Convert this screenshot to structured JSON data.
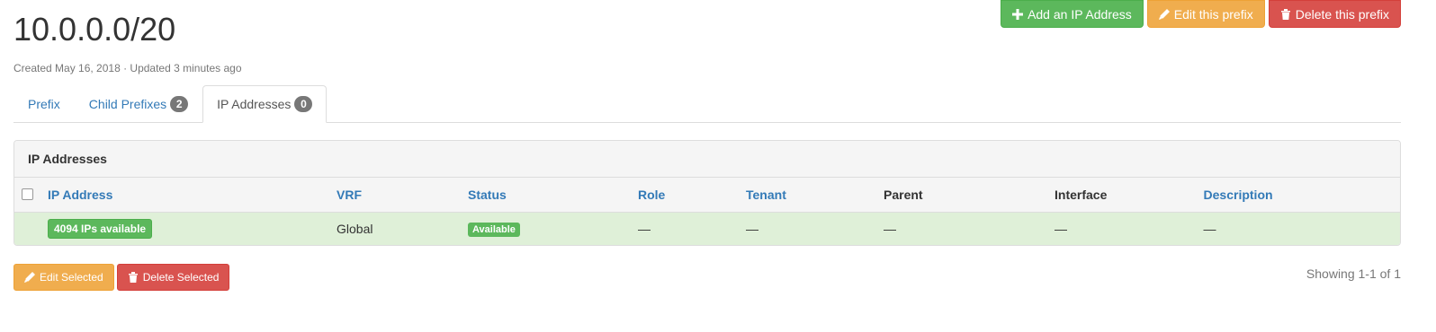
{
  "header": {
    "title": "10.0.0.0/20",
    "meta": "Created May 16, 2018 · Updated 3 minutes ago"
  },
  "actions": {
    "add_label": "Add an IP Address",
    "edit_label": "Edit this prefix",
    "delete_label": "Delete this prefix"
  },
  "tabs": [
    {
      "label": "Prefix",
      "badge": null
    },
    {
      "label": "Child Prefixes",
      "badge": "2"
    },
    {
      "label": "IP Addresses",
      "badge": "0",
      "active": true
    }
  ],
  "panel": {
    "heading": "IP Addresses",
    "columns": [
      "IP Address",
      "VRF",
      "Status",
      "Role",
      "Tenant",
      "Parent",
      "Interface",
      "Description"
    ],
    "row": {
      "ip": "4094 IPs available",
      "vrf": "Global",
      "status": "Available",
      "role": "—",
      "tenant": "—",
      "parent": "—",
      "interface": "—",
      "description": "—"
    }
  },
  "footer": {
    "edit_selected": "Edit Selected",
    "delete_selected": "Delete Selected",
    "showing": "Showing 1-1 of 1"
  },
  "colors": {
    "success": "#5cb85c",
    "warning": "#f0ad4e",
    "danger": "#d9534f",
    "link": "#337ab7",
    "row_success_bg": "#dff0d8"
  }
}
